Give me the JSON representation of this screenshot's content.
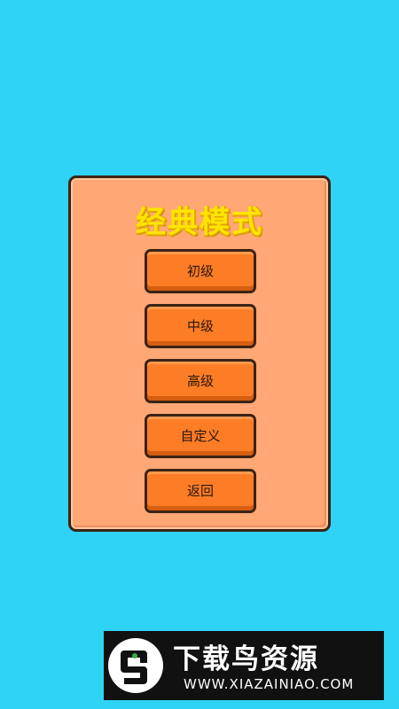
{
  "panel": {
    "title": "经典模式"
  },
  "menu": {
    "items": [
      {
        "id": "beginner",
        "label": "初级"
      },
      {
        "id": "intermediate",
        "label": "中级"
      },
      {
        "id": "advanced",
        "label": "高级"
      },
      {
        "id": "custom",
        "label": "自定义"
      },
      {
        "id": "back",
        "label": "返回"
      }
    ]
  },
  "watermark": {
    "title": "下载鸟资源",
    "url": "WWW.XIAZAINIAO.COM",
    "logo_icon": "bird-logo-icon"
  },
  "colors": {
    "background": "#2ed3f6",
    "panel": "#ffa775",
    "button": "#fd7d27",
    "title": "#ffe400",
    "border": "#3b2316"
  }
}
